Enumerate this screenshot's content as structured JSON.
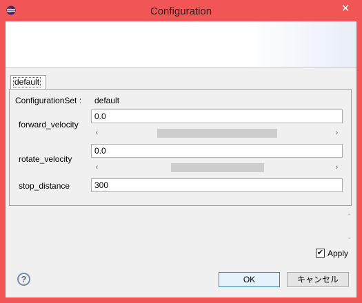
{
  "window": {
    "title": "Configuration",
    "close_glyph": "✕"
  },
  "tab": {
    "label": "default"
  },
  "config_set": {
    "label": "ConfigurationSet :",
    "value": "default"
  },
  "params": [
    {
      "label": "forward_velocity",
      "value": "0.0"
    },
    {
      "label": "rotate_velocity",
      "value": "0.0"
    },
    {
      "label": "stop_distance",
      "value": "300"
    }
  ],
  "scroll_glyphs": {
    "left": "‹",
    "right": "›",
    "up": "⌃",
    "down": "⌄"
  },
  "apply": {
    "label": "Apply",
    "checked": true,
    "check_glyph": "✔"
  },
  "buttons": {
    "ok": "OK",
    "cancel": "キャンセル"
  },
  "help_glyph": "?"
}
